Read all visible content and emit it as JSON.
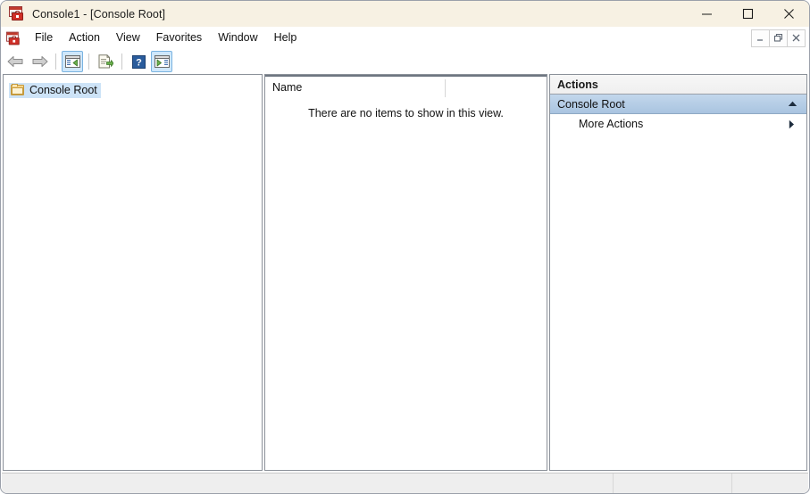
{
  "window": {
    "title": "Console1 - [Console Root]",
    "icon": "mmc-console-icon",
    "controls": {
      "minimize_label": "Minimize",
      "maximize_label": "Maximize",
      "close_label": "Close"
    }
  },
  "menubar": {
    "system_icon": "mmc-system-icon",
    "items": [
      {
        "label": "File"
      },
      {
        "label": "Action"
      },
      {
        "label": "View"
      },
      {
        "label": "Favorites"
      },
      {
        "label": "Window"
      },
      {
        "label": "Help"
      }
    ],
    "mdi_controls": {
      "minimize_label": "Minimize Document",
      "restore_label": "Restore Document",
      "close_label": "Close Document"
    }
  },
  "toolbar": {
    "buttons": [
      {
        "name": "back-button",
        "icon": "arrow-left-icon",
        "checked": false
      },
      {
        "name": "forward-button",
        "icon": "arrow-right-icon",
        "checked": false
      },
      {
        "name": "show-hide-console-tree-button",
        "icon": "console-tree-icon",
        "checked": true
      },
      {
        "name": "export-list-button",
        "icon": "export-list-icon",
        "checked": false
      },
      {
        "name": "help-button",
        "icon": "question-mark-icon",
        "checked": false
      },
      {
        "name": "show-hide-action-pane-button",
        "icon": "action-pane-icon",
        "checked": true
      }
    ]
  },
  "tree": {
    "root": {
      "label": "Console Root",
      "icon": "folder-icon",
      "selected": true
    }
  },
  "list": {
    "columns": [
      {
        "label": "Name"
      }
    ],
    "empty_message": "There are no items to show in this view.",
    "rows": []
  },
  "actions": {
    "title": "Actions",
    "group": {
      "label": "Console Root",
      "collapse_icon": "chevron-up-icon",
      "expanded": true
    },
    "items": [
      {
        "label": "More Actions",
        "submenu_icon": "triangle-right-icon"
      }
    ]
  },
  "statusbar": {
    "segments": [
      "",
      "",
      ""
    ]
  },
  "colors": {
    "titlebar_background": "#f7f1e3",
    "selection_blue": "#cde3f7",
    "actions_group_blue": "#a9c4e0",
    "pane_border": "#8b9199",
    "statusbar_background": "#eeeeee",
    "toolbar_checked": "#cfe7fb"
  }
}
